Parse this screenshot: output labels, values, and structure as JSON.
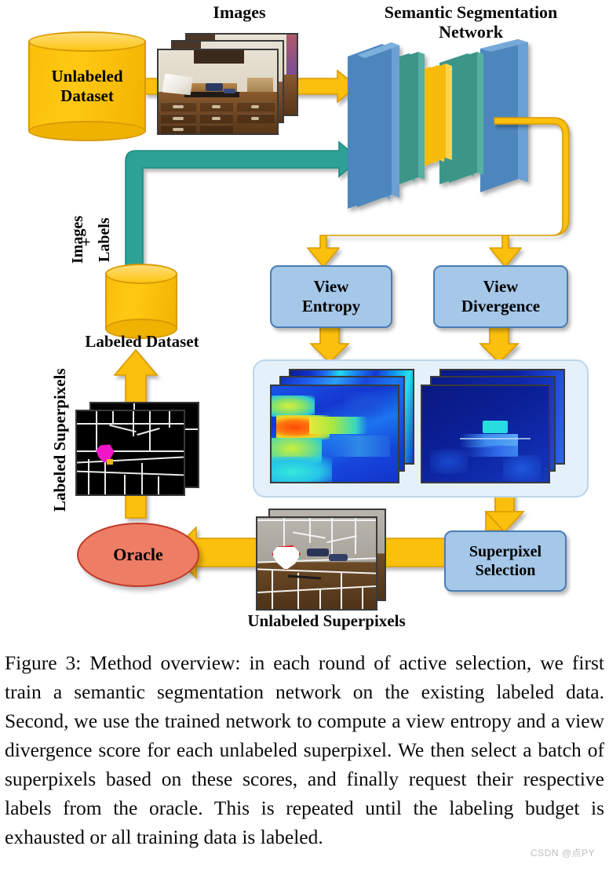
{
  "figure": {
    "number": "Figure 3",
    "caption": "Figure 3: Method overview: in each round of active selection, we first train a semantic segmentation network on the existing labeled data. Second, we use the trained network to compute a view entropy and a view divergence score for each unlabeled superpixel. We then select a batch of superpixels based on these scores, and finally request their respective labels from the oracle. This is repeated until the labeling budget is exhausted or all training data is labeled.",
    "watermark": "CSDN @点PY"
  },
  "nodes": {
    "unlabeled_dataset": {
      "line1": "Unlabeled",
      "line2": "Dataset"
    },
    "labeled_dataset_label": "Labeled Dataset",
    "images_label": "Images",
    "network_title": {
      "line1": "Semantic Segmentation",
      "line2": "Network"
    },
    "view_entropy": {
      "line1": "View",
      "line2": "Entropy"
    },
    "view_divergence": {
      "line1": "View",
      "line2": "Divergence"
    },
    "superpixel_selection": {
      "line1": "Superpixel",
      "line2": "Selection"
    },
    "oracle": "Oracle",
    "unlabeled_superpixels_label": "Unlabeled Superpixels",
    "labeled_superpixels_label": "Labeled Superpixels",
    "images_plus_labels": {
      "images": "Images",
      "plus": "+",
      "labels": "Labels"
    }
  },
  "colors": {
    "yellow_arrow": "#FBBF07",
    "yellow_arrow_border": "#D89A05",
    "teal_arrow": "#2FA196",
    "teal_arrow_border": "#1E8C82",
    "process_box_fill": "#A5C7E8",
    "process_box_border": "#4A7DB5",
    "oracle_fill": "#ED7D64",
    "oracle_border": "#C0392B",
    "panel_fill": "#E4F0FA",
    "panel_border": "#BCD6EA",
    "net_blue": "#4E86BD",
    "net_teal": "#3C9588",
    "net_yellow": "#FBBF07",
    "labeled_selection": "#EF16C8"
  },
  "network_layers": [
    {
      "kind": "blue"
    },
    {
      "kind": "blue"
    },
    {
      "kind": "teal"
    },
    {
      "kind": "teal"
    },
    {
      "kind": "yellow"
    },
    {
      "kind": "yellow"
    },
    {
      "kind": "yellow"
    },
    {
      "kind": "teal"
    },
    {
      "kind": "teal"
    },
    {
      "kind": "blue-large"
    }
  ],
  "heatmaps": {
    "entropy_stack_count": 3,
    "divergence_stack_count": 3,
    "entropy_colormap": "jet-high-variance",
    "divergence_colormap": "jet-low-variance"
  }
}
